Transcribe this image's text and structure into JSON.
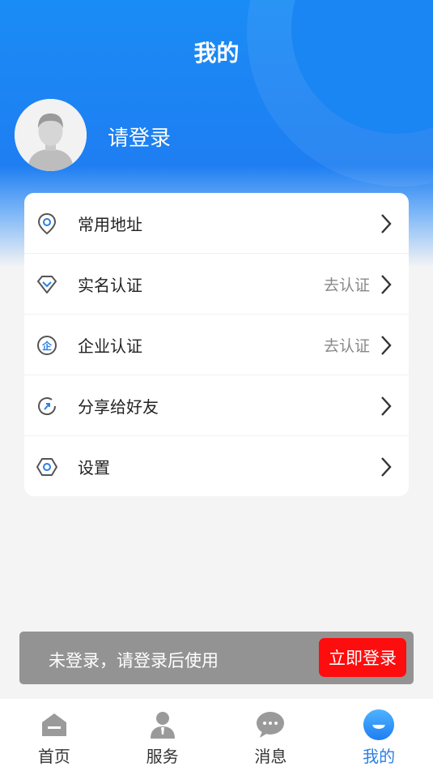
{
  "header": {
    "title": "我的",
    "login_prompt": "请登录"
  },
  "menu": {
    "items": [
      {
        "label": "常用地址",
        "hint": "",
        "icon": "location-pin-icon"
      },
      {
        "label": "实名认证",
        "hint": "去认证",
        "icon": "diamond-check-icon"
      },
      {
        "label": "企业认证",
        "hint": "去认证",
        "icon": "enterprise-icon"
      },
      {
        "label": "分享给好友",
        "hint": "",
        "icon": "share-icon"
      },
      {
        "label": "设置",
        "hint": "",
        "icon": "hexagon-settings-icon"
      }
    ]
  },
  "banner": {
    "text": "未登录，请登录后使用",
    "button_label": "立即登录"
  },
  "tabbar": {
    "items": [
      {
        "label": "首页",
        "icon": "home-icon",
        "active": false
      },
      {
        "label": "服务",
        "icon": "service-person-icon",
        "active": false
      },
      {
        "label": "消息",
        "icon": "message-icon",
        "active": false
      },
      {
        "label": "我的",
        "icon": "profile-icon",
        "active": true
      }
    ]
  },
  "colors": {
    "primary": "#1e7ef2",
    "accent_red": "#fd0d0d",
    "active_tab": "#2b7fe6",
    "banner_bg": "#939393"
  }
}
